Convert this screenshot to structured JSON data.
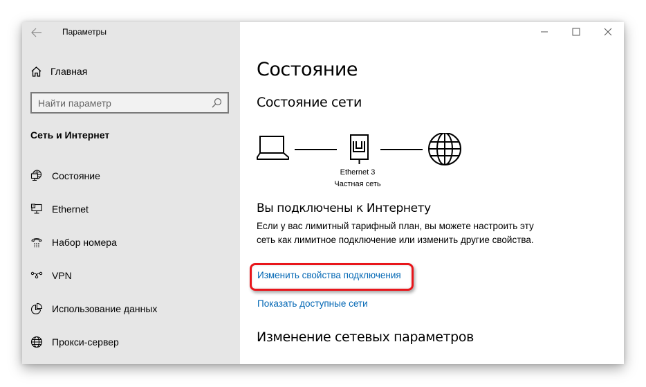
{
  "window": {
    "title": "Параметры",
    "controls": {
      "minimize": "minimize",
      "maximize": "maximize",
      "close": "close"
    }
  },
  "sidebar": {
    "home_label": "Главная",
    "search": {
      "placeholder": "Найти параметр",
      "value": ""
    },
    "section_heading": "Сеть и Интернет",
    "items": [
      {
        "label": "Состояние",
        "icon": "network-status-icon",
        "selected": true
      },
      {
        "label": "Ethernet",
        "icon": "ethernet-icon",
        "selected": false
      },
      {
        "label": "Набор номера",
        "icon": "dialup-icon",
        "selected": false
      },
      {
        "label": "VPN",
        "icon": "vpn-icon",
        "selected": false
      },
      {
        "label": "Использование данных",
        "icon": "data-usage-icon",
        "selected": false
      },
      {
        "label": "Прокси-сервер",
        "icon": "globe-icon",
        "selected": false
      }
    ]
  },
  "main": {
    "title": "Состояние",
    "network_status_heading": "Состояние сети",
    "diagram": {
      "adapter_name": "Ethernet 3",
      "network_type": "Частная сеть"
    },
    "connected_heading": "Вы подключены к Интернету",
    "info_text": "Если у вас лимитный тарифный план, вы можете настроить эту сеть как лимитное подключение или изменить другие свойства.",
    "links": {
      "change_properties": "Изменить свойства подключения",
      "show_networks": "Показать доступные сети"
    },
    "change_settings_heading": "Изменение сетевых параметров"
  },
  "colors": {
    "sidebar_bg": "#e6e6e6",
    "link": "#0066b4",
    "highlight": "#e8161b"
  }
}
